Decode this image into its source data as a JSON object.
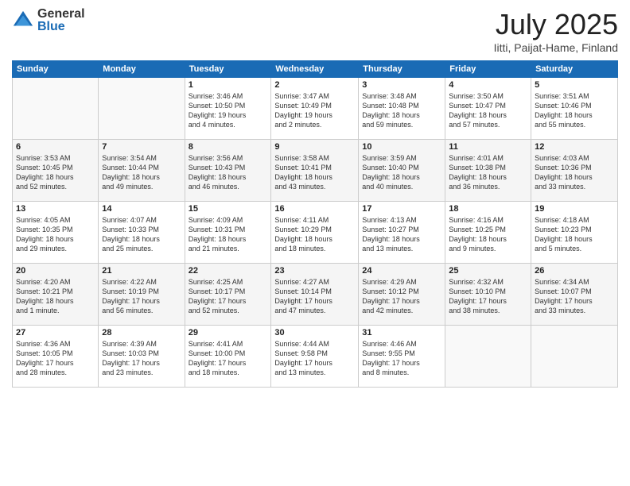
{
  "logo": {
    "general": "General",
    "blue": "Blue"
  },
  "header": {
    "month": "July 2025",
    "location": "Iitti, Paijat-Hame, Finland"
  },
  "weekdays": [
    "Sunday",
    "Monday",
    "Tuesday",
    "Wednesday",
    "Thursday",
    "Friday",
    "Saturday"
  ],
  "weeks": [
    [
      {
        "day": "",
        "info": ""
      },
      {
        "day": "",
        "info": ""
      },
      {
        "day": "1",
        "info": "Sunrise: 3:46 AM\nSunset: 10:50 PM\nDaylight: 19 hours\nand 4 minutes."
      },
      {
        "day": "2",
        "info": "Sunrise: 3:47 AM\nSunset: 10:49 PM\nDaylight: 19 hours\nand 2 minutes."
      },
      {
        "day": "3",
        "info": "Sunrise: 3:48 AM\nSunset: 10:48 PM\nDaylight: 18 hours\nand 59 minutes."
      },
      {
        "day": "4",
        "info": "Sunrise: 3:50 AM\nSunset: 10:47 PM\nDaylight: 18 hours\nand 57 minutes."
      },
      {
        "day": "5",
        "info": "Sunrise: 3:51 AM\nSunset: 10:46 PM\nDaylight: 18 hours\nand 55 minutes."
      }
    ],
    [
      {
        "day": "6",
        "info": "Sunrise: 3:53 AM\nSunset: 10:45 PM\nDaylight: 18 hours\nand 52 minutes."
      },
      {
        "day": "7",
        "info": "Sunrise: 3:54 AM\nSunset: 10:44 PM\nDaylight: 18 hours\nand 49 minutes."
      },
      {
        "day": "8",
        "info": "Sunrise: 3:56 AM\nSunset: 10:43 PM\nDaylight: 18 hours\nand 46 minutes."
      },
      {
        "day": "9",
        "info": "Sunrise: 3:58 AM\nSunset: 10:41 PM\nDaylight: 18 hours\nand 43 minutes."
      },
      {
        "day": "10",
        "info": "Sunrise: 3:59 AM\nSunset: 10:40 PM\nDaylight: 18 hours\nand 40 minutes."
      },
      {
        "day": "11",
        "info": "Sunrise: 4:01 AM\nSunset: 10:38 PM\nDaylight: 18 hours\nand 36 minutes."
      },
      {
        "day": "12",
        "info": "Sunrise: 4:03 AM\nSunset: 10:36 PM\nDaylight: 18 hours\nand 33 minutes."
      }
    ],
    [
      {
        "day": "13",
        "info": "Sunrise: 4:05 AM\nSunset: 10:35 PM\nDaylight: 18 hours\nand 29 minutes."
      },
      {
        "day": "14",
        "info": "Sunrise: 4:07 AM\nSunset: 10:33 PM\nDaylight: 18 hours\nand 25 minutes."
      },
      {
        "day": "15",
        "info": "Sunrise: 4:09 AM\nSunset: 10:31 PM\nDaylight: 18 hours\nand 21 minutes."
      },
      {
        "day": "16",
        "info": "Sunrise: 4:11 AM\nSunset: 10:29 PM\nDaylight: 18 hours\nand 18 minutes."
      },
      {
        "day": "17",
        "info": "Sunrise: 4:13 AM\nSunset: 10:27 PM\nDaylight: 18 hours\nand 13 minutes."
      },
      {
        "day": "18",
        "info": "Sunrise: 4:16 AM\nSunset: 10:25 PM\nDaylight: 18 hours\nand 9 minutes."
      },
      {
        "day": "19",
        "info": "Sunrise: 4:18 AM\nSunset: 10:23 PM\nDaylight: 18 hours\nand 5 minutes."
      }
    ],
    [
      {
        "day": "20",
        "info": "Sunrise: 4:20 AM\nSunset: 10:21 PM\nDaylight: 18 hours\nand 1 minute."
      },
      {
        "day": "21",
        "info": "Sunrise: 4:22 AM\nSunset: 10:19 PM\nDaylight: 17 hours\nand 56 minutes."
      },
      {
        "day": "22",
        "info": "Sunrise: 4:25 AM\nSunset: 10:17 PM\nDaylight: 17 hours\nand 52 minutes."
      },
      {
        "day": "23",
        "info": "Sunrise: 4:27 AM\nSunset: 10:14 PM\nDaylight: 17 hours\nand 47 minutes."
      },
      {
        "day": "24",
        "info": "Sunrise: 4:29 AM\nSunset: 10:12 PM\nDaylight: 17 hours\nand 42 minutes."
      },
      {
        "day": "25",
        "info": "Sunrise: 4:32 AM\nSunset: 10:10 PM\nDaylight: 17 hours\nand 38 minutes."
      },
      {
        "day": "26",
        "info": "Sunrise: 4:34 AM\nSunset: 10:07 PM\nDaylight: 17 hours\nand 33 minutes."
      }
    ],
    [
      {
        "day": "27",
        "info": "Sunrise: 4:36 AM\nSunset: 10:05 PM\nDaylight: 17 hours\nand 28 minutes."
      },
      {
        "day": "28",
        "info": "Sunrise: 4:39 AM\nSunset: 10:03 PM\nDaylight: 17 hours\nand 23 minutes."
      },
      {
        "day": "29",
        "info": "Sunrise: 4:41 AM\nSunset: 10:00 PM\nDaylight: 17 hours\nand 18 minutes."
      },
      {
        "day": "30",
        "info": "Sunrise: 4:44 AM\nSunset: 9:58 PM\nDaylight: 17 hours\nand 13 minutes."
      },
      {
        "day": "31",
        "info": "Sunrise: 4:46 AM\nSunset: 9:55 PM\nDaylight: 17 hours\nand 8 minutes."
      },
      {
        "day": "",
        "info": ""
      },
      {
        "day": "",
        "info": ""
      }
    ]
  ]
}
